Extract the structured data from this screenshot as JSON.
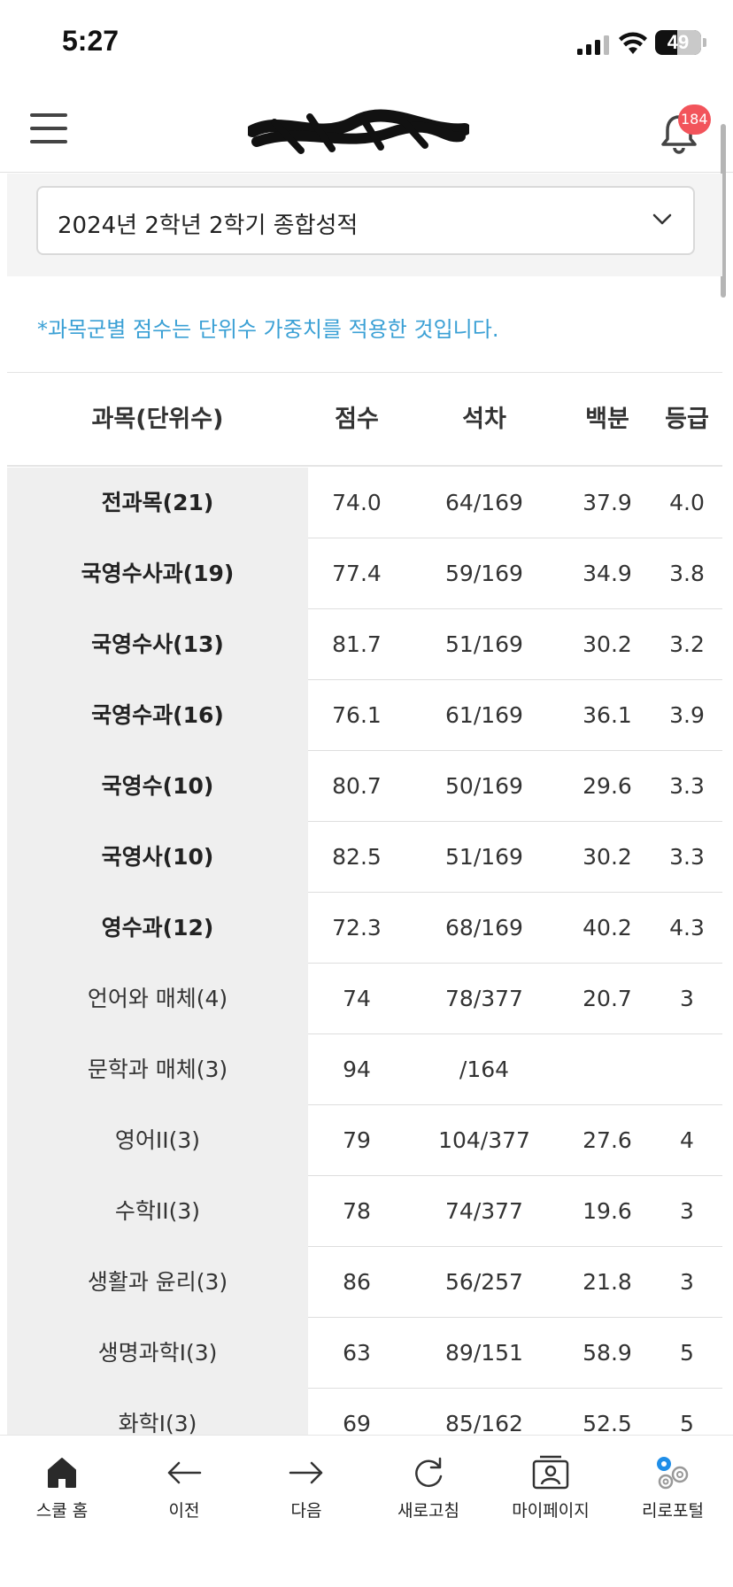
{
  "status_bar": {
    "time": "5:27",
    "battery": "49",
    "battery_level": 0.49
  },
  "header": {
    "notification_count": "184"
  },
  "selector": {
    "value": "2024년 2학년 2학기 종합성적"
  },
  "note": "*과목군별 점수는 단위수 가중치를 적용한 것입니다.",
  "table": {
    "columns": [
      "과목(단위수)",
      "점수",
      "석차",
      "백분",
      "등급"
    ],
    "rows": [
      {
        "subject": "전과목(21)",
        "score": "74.0",
        "rank": "64/169",
        "percent": "37.9",
        "grade": "4.0",
        "bold": true
      },
      {
        "subject": "국영수사과(19)",
        "score": "77.4",
        "rank": "59/169",
        "percent": "34.9",
        "grade": "3.8",
        "bold": true
      },
      {
        "subject": "국영수사(13)",
        "score": "81.7",
        "rank": "51/169",
        "percent": "30.2",
        "grade": "3.2",
        "bold": true
      },
      {
        "subject": "국영수과(16)",
        "score": "76.1",
        "rank": "61/169",
        "percent": "36.1",
        "grade": "3.9",
        "bold": true
      },
      {
        "subject": "국영수(10)",
        "score": "80.7",
        "rank": "50/169",
        "percent": "29.6",
        "grade": "3.3",
        "bold": true
      },
      {
        "subject": "국영사(10)",
        "score": "82.5",
        "rank": "51/169",
        "percent": "30.2",
        "grade": "3.3",
        "bold": true
      },
      {
        "subject": "영수과(12)",
        "score": "72.3",
        "rank": "68/169",
        "percent": "40.2",
        "grade": "4.3",
        "bold": true
      },
      {
        "subject": "언어와 매체(4)",
        "score": "74",
        "rank": "78/377",
        "percent": "20.7",
        "grade": "3",
        "bold": false
      },
      {
        "subject": "문학과 매체(3)",
        "score": "94",
        "rank": "/164",
        "percent": "",
        "grade": "",
        "bold": false
      },
      {
        "subject": "영어II(3)",
        "score": "79",
        "rank": "104/377",
        "percent": "27.6",
        "grade": "4",
        "bold": false
      },
      {
        "subject": "수학II(3)",
        "score": "78",
        "rank": "74/377",
        "percent": "19.6",
        "grade": "3",
        "bold": false
      },
      {
        "subject": "생활과 윤리(3)",
        "score": "86",
        "rank": "56/257",
        "percent": "21.8",
        "grade": "3",
        "bold": false
      },
      {
        "subject": "생명과학I(3)",
        "score": "63",
        "rank": "89/151",
        "percent": "58.9",
        "grade": "5",
        "bold": false
      },
      {
        "subject": "화학I(3)",
        "score": "69",
        "rank": "85/162",
        "percent": "52.5",
        "grade": "5",
        "bold": false
      }
    ]
  },
  "bottom_nav": [
    {
      "label": "스쿨 홈",
      "icon": "home-icon"
    },
    {
      "label": "이전",
      "icon": "arrow-left-icon"
    },
    {
      "label": "다음",
      "icon": "arrow-right-icon"
    },
    {
      "label": "새로고침",
      "icon": "refresh-icon"
    },
    {
      "label": "마이페이지",
      "icon": "profile-card-icon"
    },
    {
      "label": "리로포털",
      "icon": "portal-icon"
    }
  ]
}
